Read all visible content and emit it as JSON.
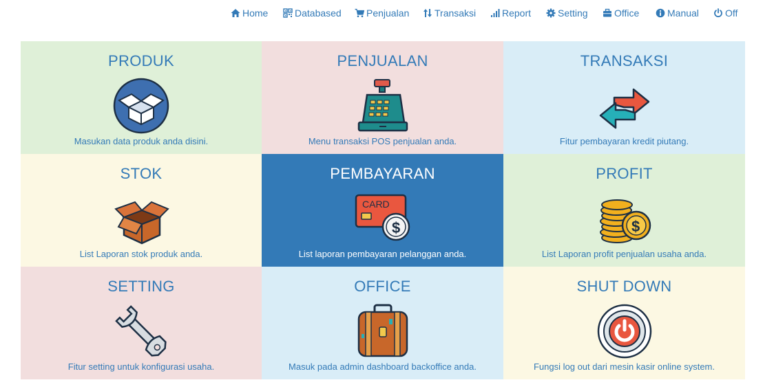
{
  "nav": {
    "items": [
      {
        "label": "Home",
        "icon": "home-icon"
      },
      {
        "label": "Databased",
        "icon": "qrcode-icon"
      },
      {
        "label": "Penjualan",
        "icon": "shopping-cart-icon"
      },
      {
        "label": "Transaksi",
        "icon": "sort-arrows-icon"
      },
      {
        "label": "Report",
        "icon": "signal-bars-icon"
      },
      {
        "label": "Setting",
        "icon": "cog-icon"
      },
      {
        "label": "Office",
        "icon": "briefcase-icon"
      },
      {
        "label": "Manual",
        "icon": "info-circle-icon"
      },
      {
        "label": "Off",
        "icon": "power-icon"
      }
    ]
  },
  "tiles": [
    {
      "title": "PRODUK",
      "desc": "Masukan data produk anda disini.",
      "icon": "open-box-icon"
    },
    {
      "title": "PENJUALAN",
      "desc": "Menu transaksi POS penjualan anda.",
      "icon": "cash-register-icon"
    },
    {
      "title": "TRANSAKSI",
      "desc": "Fitur pembayaran kredit piutang.",
      "icon": "exchange-arrows-icon"
    },
    {
      "title": "STOK",
      "desc": "List Laporan stok produk anda.",
      "icon": "cardboard-box-icon"
    },
    {
      "title": "PEMBAYARAN",
      "desc": "List laporan pembayaran pelanggan anda.",
      "icon": "credit-card-icon",
      "card_text": "CARD"
    },
    {
      "title": "PROFIT",
      "desc": "List Laporan profit penjualan usaha anda.",
      "icon": "coin-stack-icon"
    },
    {
      "title": "SETTING",
      "desc": "Fitur setting untuk konfigurasi usaha.",
      "icon": "wrench-icon"
    },
    {
      "title": "OFFICE",
      "desc": "Masuk pada admin dashboard backoffice anda.",
      "icon": "suitcase-icon"
    },
    {
      "title": "SHUT DOWN",
      "desc": "Fungsi log out dari mesin kasir online system.",
      "icon": "power-button-icon"
    }
  ],
  "colors": {
    "link": "#337ab7",
    "green": "#dff0d8",
    "red": "#f2dede",
    "blue": "#d9edf7",
    "yellow": "#fcf8e3",
    "active": "#337ab7"
  }
}
